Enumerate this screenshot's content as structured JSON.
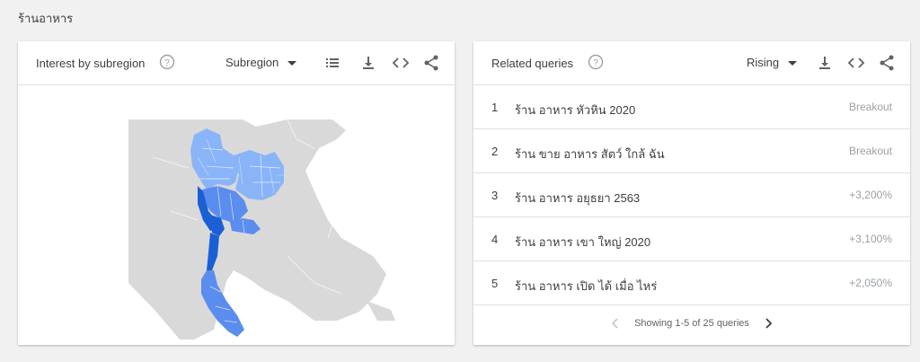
{
  "page": {
    "title": "ร้านอาหาร"
  },
  "interest_card": {
    "title": "Interest by subregion",
    "dropdown_label": "Subregion",
    "map_region": "Thailand"
  },
  "queries_card": {
    "title": "Related queries",
    "dropdown_label": "Rising",
    "rows": [
      {
        "rank": "1",
        "query": "ร้าน อาหาร หัวหิน 2020",
        "value": "Breakout"
      },
      {
        "rank": "2",
        "query": "ร้าน ขาย อาหาร สัตว์ ใกล้ ฉัน",
        "value": "Breakout"
      },
      {
        "rank": "3",
        "query": "ร้าน อาหาร อยุธยา 2563",
        "value": "+3,200%"
      },
      {
        "rank": "4",
        "query": "ร้าน อาหาร เขา ใหญ่ 2020",
        "value": "+3,100%"
      },
      {
        "rank": "5",
        "query": "ร้าน อาหาร เปิด ได้ เมื่อ ไหร่",
        "value": "+2,050%"
      }
    ],
    "pagination": "Showing 1-5 of 25 queries"
  },
  "colors": {
    "background": "#f1f1f1",
    "card": "#ffffff",
    "map_land": "#d9d9d9",
    "map_light": "#8ab4f8",
    "map_mid": "#5b8def",
    "map_dark": "#1a5fd6"
  },
  "icons": [
    "help-icon",
    "caret-down-icon",
    "list-icon",
    "download-icon",
    "embed-icon",
    "share-icon",
    "chevron-left-icon",
    "chevron-right-icon"
  ]
}
